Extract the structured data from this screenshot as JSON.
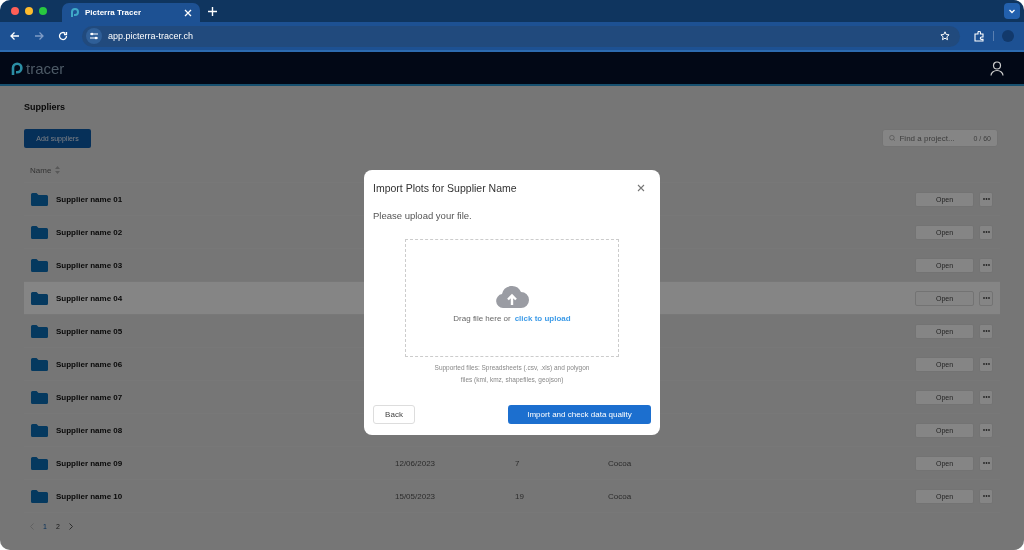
{
  "browser": {
    "tabs": [
      {
        "title": "Picterra Tracer",
        "selected": true
      }
    ],
    "address": "app.picterra-tracer.ch"
  },
  "app": {
    "logo_text": "tracer"
  },
  "page": {
    "title": "Suppliers",
    "add_button": "Add suppliers",
    "search": {
      "placeholder": "Find a project...",
      "count": "0 / 60"
    },
    "table": {
      "columns": [
        {
          "label": "Name"
        }
      ],
      "rows": [
        {
          "name": "Supplier name 01",
          "hovered": false,
          "action": "Open"
        },
        {
          "name": "Supplier name 02",
          "hovered": false,
          "action": "Open"
        },
        {
          "name": "Supplier name 03",
          "hovered": false,
          "action": "Open"
        },
        {
          "name": "Supplier name 04",
          "hovered": true,
          "action": "Open"
        },
        {
          "name": "Supplier name 05",
          "hovered": false,
          "action": "Open"
        },
        {
          "name": "Supplier name 06",
          "hovered": false,
          "action": "Open"
        },
        {
          "name": "Supplier name 07",
          "hovered": false,
          "action": "Open"
        },
        {
          "name": "Supplier name 08",
          "hovered": false,
          "action": "Open"
        },
        {
          "name": "Supplier name 09",
          "hovered": false,
          "analysed": "12/06/2023",
          "plots": "7",
          "commodity": "Cocoa",
          "action": "Open"
        },
        {
          "name": "Supplier name 10",
          "hovered": false,
          "analysed": "15/05/2023",
          "plots": "19",
          "commodity": "Cocoa",
          "action": "Open"
        }
      ]
    },
    "pagination": {
      "pages": [
        {
          "label": "1",
          "selected": true
        },
        {
          "label": "2",
          "selected": false
        }
      ]
    }
  },
  "modal": {
    "title": "Import Plots for Supplier Name",
    "prompt": "Please upload your file.",
    "drop_text": "Drag file here or",
    "upload_link": "click to upload",
    "supported": "Supported files: Spreadsheets (.csv, .xls) and polygon files (kml, kmz, shapefiles, geojson)",
    "back_button": "Back",
    "import_button": "Import and check data quality"
  }
}
